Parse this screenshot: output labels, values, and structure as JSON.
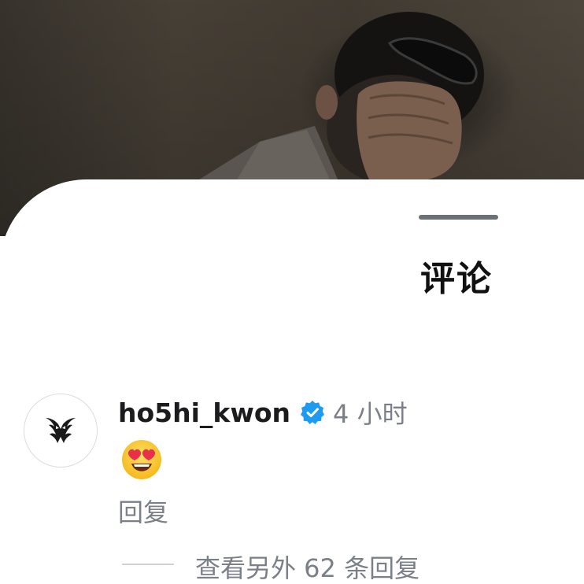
{
  "sheet": {
    "title": "评论"
  },
  "comment": {
    "username": "ho5hi_kwon",
    "verified": true,
    "time": "4 小时",
    "body_emoji": "heart-eyes-emoji",
    "reply_label": "回复",
    "view_replies_label": "查看另外 62 条回复"
  },
  "colors": {
    "verified_blue": "#1d9bf0",
    "secondary_text": "#7b8088",
    "grabber": "#6b7079"
  },
  "icons": {
    "avatar": "tiger-logo-icon",
    "verified": "verified-badge-icon"
  }
}
